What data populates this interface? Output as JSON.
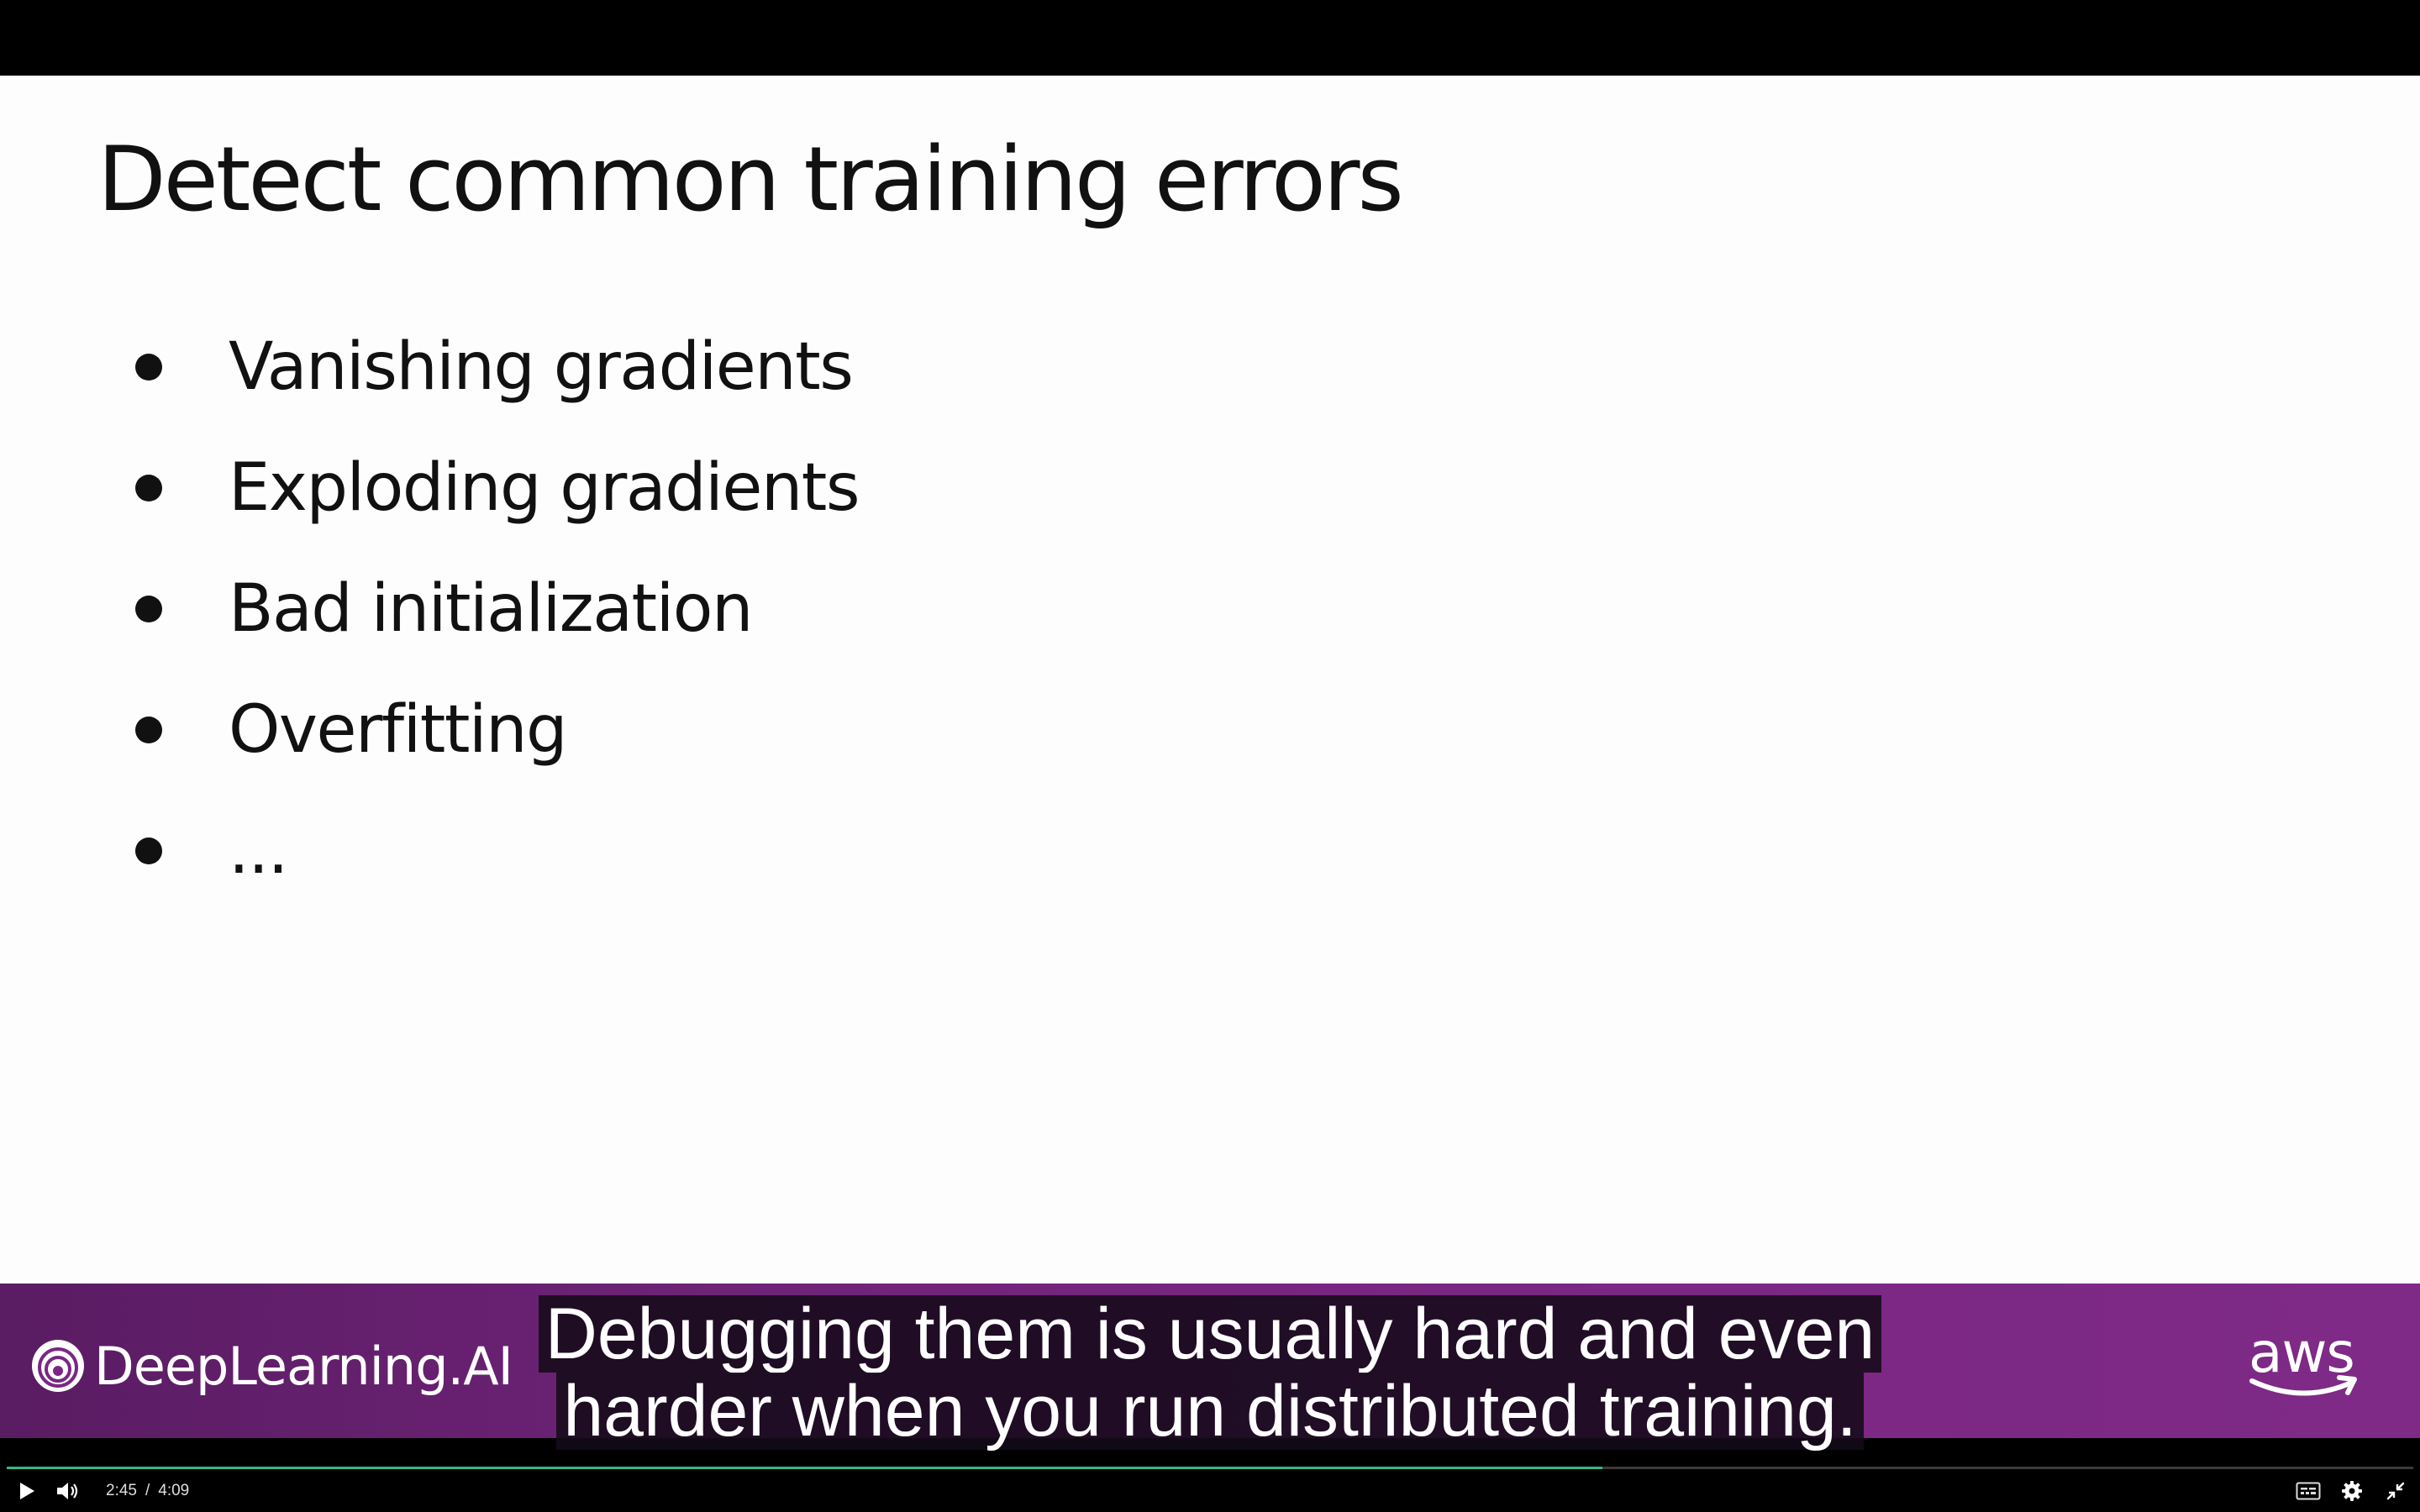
{
  "slide": {
    "title": "Detect common training errors",
    "bullets": [
      "Vanishing gradients",
      "Exploding gradients",
      "Bad initialization",
      "Overfitting",
      "..."
    ]
  },
  "branding": {
    "left_logo_text": "DeepLearning.AI",
    "left_logo_icon": "deeplearning-ai-logo-icon",
    "right_logo_text": "aws",
    "right_logo_icon": "aws-smile-icon",
    "band_color": "#7a2783"
  },
  "captions": {
    "lines": [
      "Debugging them is usually hard and even",
      "harder when you run distributed training."
    ]
  },
  "player": {
    "current_time": "2:45",
    "separator": "/",
    "duration": "4:09",
    "progress_fraction": 0.663,
    "progress_color": "#2fb98a",
    "icons": {
      "play": "play-icon",
      "volume": "volume-icon",
      "captions": "closed-captions-icon",
      "settings": "gear-icon",
      "exit_fullscreen": "exit-fullscreen-icon"
    }
  }
}
